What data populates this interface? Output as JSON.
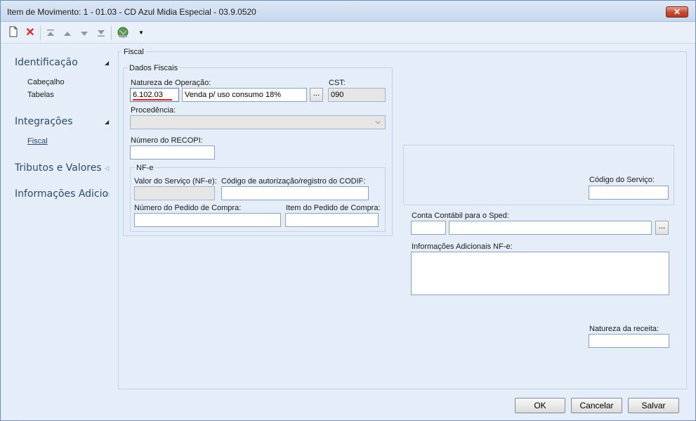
{
  "window": {
    "title": "Item de Movimento: 1 - 01.03 - CD Azul Midia Especial - 03.9.0520",
    "close_glyph": "✕"
  },
  "toolbar": {
    "icons": [
      "new-document-icon",
      "delete-icon",
      "first-record-icon",
      "previous-record-icon",
      "next-record-icon",
      "last-record-icon",
      "globe-icon",
      "dropdown-arrow-icon"
    ]
  },
  "sidebar": {
    "sections": [
      {
        "label": "Identificação",
        "items": [
          "Cabeçalho",
          "Tabelas"
        ]
      },
      {
        "label": "Integrações",
        "items": [
          "Fiscal"
        ]
      },
      {
        "label": "Tributos e Valores",
        "items": []
      },
      {
        "label": "Informações Adicio",
        "items": []
      }
    ]
  },
  "fiscal": {
    "title": "Fiscal",
    "dados_fiscais": {
      "title": "Dados Fiscais",
      "natureza_label": "Natureza de Operação:",
      "natureza_code": "6.102.03",
      "natureza_desc": "Venda p/ uso consumo 18%",
      "ellipsis": "...",
      "cst_label": "CST:",
      "cst_value": "090",
      "procedencia_label": "Procedência:",
      "procedencia_value": "",
      "recopi_label": "Número do RECOPI:",
      "recopi_value": ""
    },
    "nfe": {
      "title": "NF-e",
      "valor_servico_label": "Valor do Serviço (NF-e):",
      "valor_servico_value": "",
      "codif_label": "Código de autorização/registro do CODIF:",
      "codif_value": "",
      "pedido_label": "Número do Pedido de Compra:",
      "pedido_value": "",
      "item_pedido_label": "Item do Pedido de Compra:",
      "item_pedido_value": ""
    },
    "codigo_servico_label": "Código do Serviço:",
    "codigo_servico_value": "",
    "conta_contabil_label": "Conta Contábil para o Sped:",
    "conta_contabil_code": "",
    "conta_contabil_desc": "",
    "info_adicionais_label": "Informações Adicionais NF-e:",
    "info_adicionais_value": "",
    "natureza_receita_label": "Natureza da receita:",
    "natureza_receita_value": ""
  },
  "footer": {
    "ok": "OK",
    "cancel": "Cancelar",
    "save": "Salvar"
  }
}
